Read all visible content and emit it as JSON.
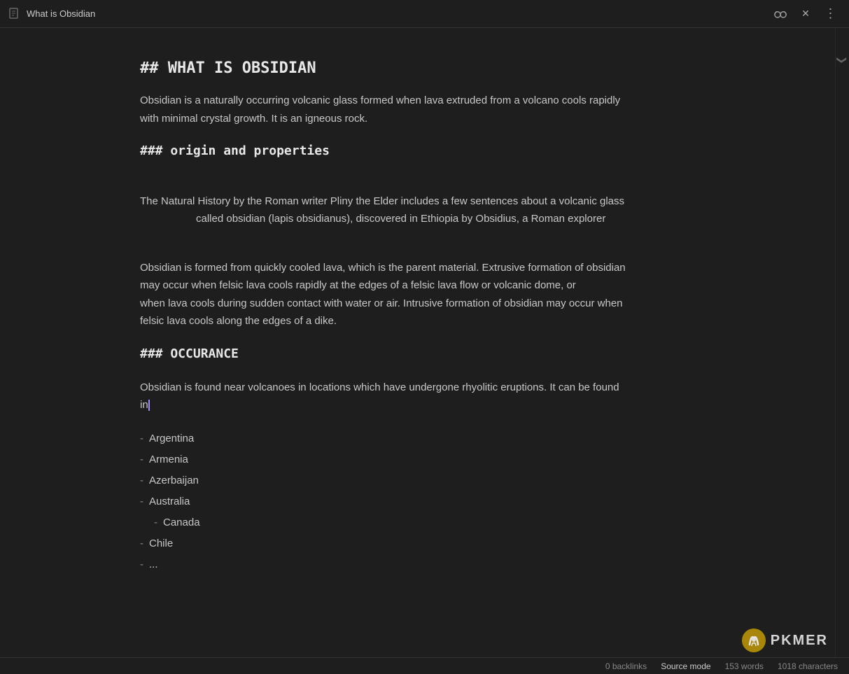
{
  "titlebar": {
    "title": "What is Obsidian",
    "icon_label": "document-icon",
    "btn_glasses": "⌘",
    "btn_close": "✕",
    "btn_more": "⋮"
  },
  "content": {
    "heading_main": "## WHAT IS OBSIDIAN",
    "intro_paragraph": "Obsidian is a naturally occurring volcanic glass formed when lava extruded from a volcano cools rapidly with minimal crystal growth. It is an igneous rock.",
    "heading_origin": "### origin and properties",
    "origin_paragraph": "The Natural History by the Roman writer Pliny the Elder includes a few sentences about a volcanic glass                       called obsidian (lapis obsidianus), discovered in Ethiopia by Obsidius, a Roman explorer",
    "formation_paragraph": "Obsidian is formed from quickly cooled lava, which is the parent material. Extrusive formation of obsidian may occur when felsic lava cools rapidly at the edges of a felsic lava flow or volcanic dome, or              when lava cools during sudden contact with water or air. Intrusive formation of obsidian may occur when felsic lava cools along the edges of a dike.",
    "heading_occurrence": "### OCCURANCE",
    "occurrence_intro": "Obsidian is found near volcanoes in locations which have undergone rhyolitic eruptions. It can be found in",
    "list_items": [
      {
        "indent": false,
        "text": "Argentina"
      },
      {
        "indent": false,
        "text": "Armenia"
      },
      {
        "indent": false,
        "text": "Azerbaijan"
      },
      {
        "indent": false,
        "text": "Australia"
      },
      {
        "indent": true,
        "text": "Canada"
      },
      {
        "indent": false,
        "text": "Chile"
      },
      {
        "indent": false,
        "text": "..."
      }
    ]
  },
  "statusbar": {
    "backlinks": "0 backlinks",
    "source_mode": "Source mode",
    "word_count": "153 words",
    "char_count": "1018 characters"
  },
  "pkmer": {
    "text": "PKMER"
  },
  "sidebar_collapse": "❯"
}
